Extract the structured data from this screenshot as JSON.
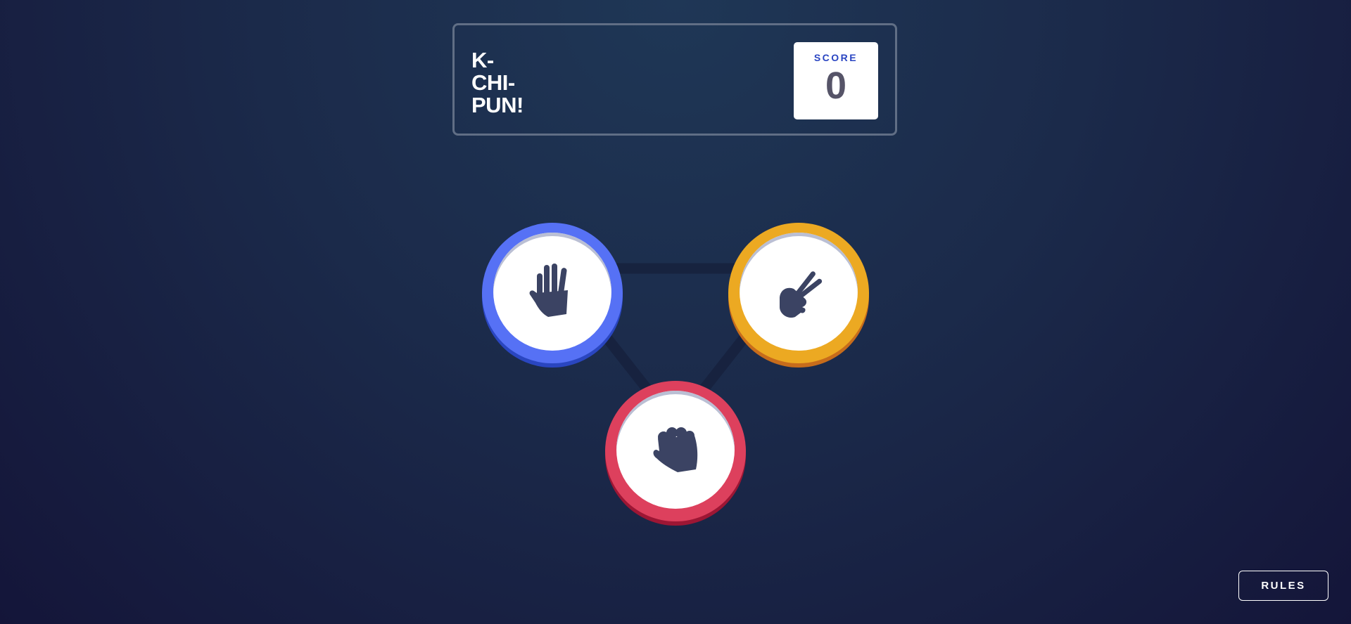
{
  "header": {
    "title": "K-\nCHI-\nPUN!",
    "score_label": "SCORE",
    "score_value": "0"
  },
  "choices": [
    {
      "id": "paper",
      "icon": "hand-paper-icon",
      "color": "#5671f5"
    },
    {
      "id": "scissors",
      "icon": "hand-scissors-icon",
      "color": "#eca922"
    },
    {
      "id": "rock",
      "icon": "hand-rock-icon",
      "color": "#dd405d"
    }
  ],
  "rules_button": {
    "label": "RULES"
  },
  "colors": {
    "background_top": "#1f3756",
    "background_bottom": "#141539",
    "icon": "#3b4363",
    "score_label": "#2a45c2",
    "score_value": "#565468",
    "outline": "#606e85"
  }
}
